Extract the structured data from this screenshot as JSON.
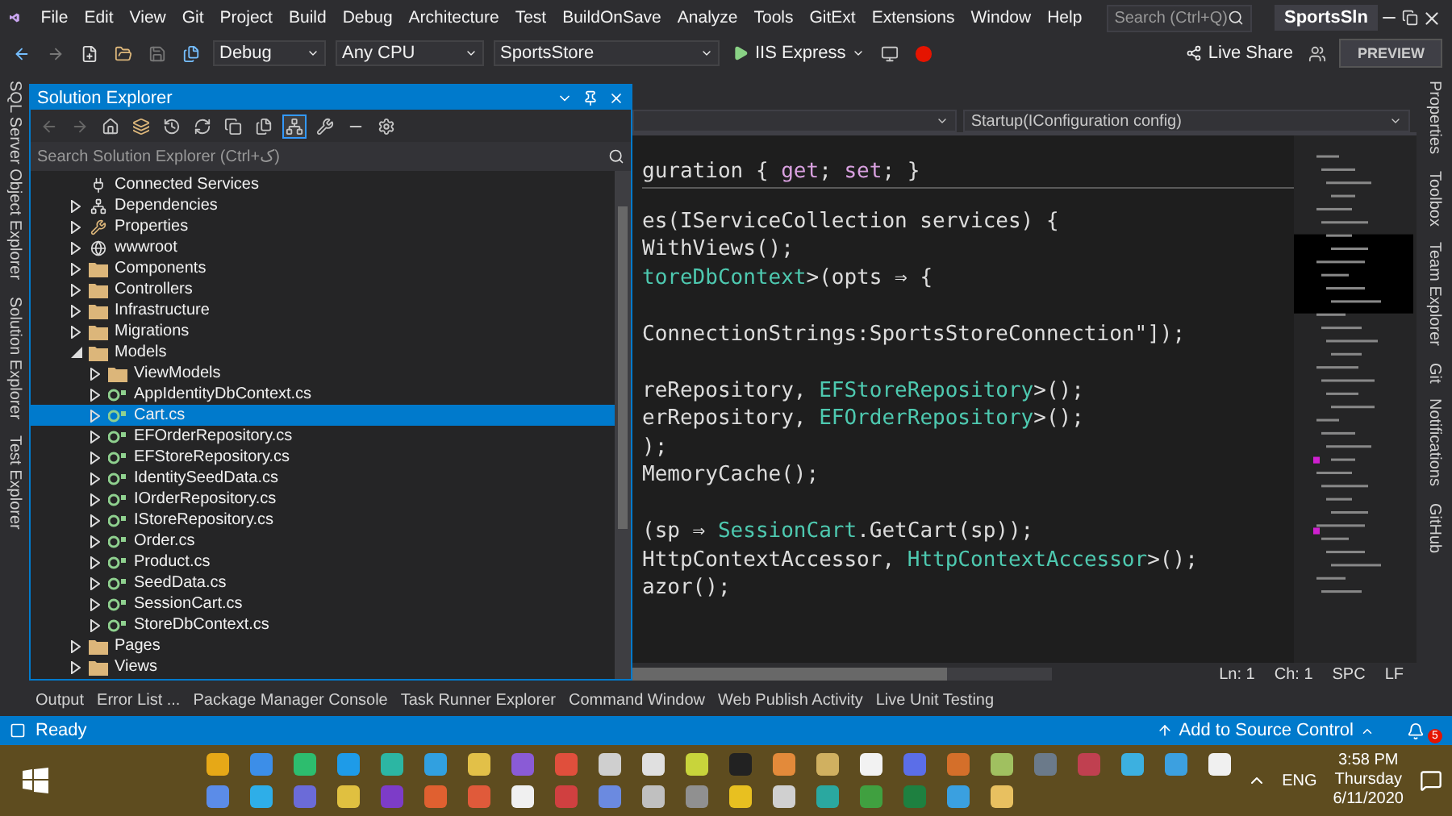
{
  "menu_bar": {
    "items": [
      "File",
      "Edit",
      "View",
      "Git",
      "Project",
      "Build",
      "Debug",
      "Architecture",
      "Test",
      "BuildOnSave",
      "Analyze",
      "Tools",
      "GitExt",
      "Extensions",
      "Window",
      "Help"
    ],
    "search": {
      "placeholder": "Search (Ctrl+Q)"
    },
    "solution_name": "SportsSln"
  },
  "toolbar": {
    "configuration": "Debug",
    "platform": "Any CPU",
    "startup_project": "SportsStore",
    "run_target": "IIS Express",
    "live_share": "Live Share",
    "preview": "PREVIEW"
  },
  "left_tabs": [
    "SQL Server Object Explorer",
    "Solution Explorer",
    "Test Explorer"
  ],
  "right_tabs": [
    "Properties",
    "Toolbox",
    "Team Explorer",
    "Git",
    "Notifications",
    "GitHub"
  ],
  "solution_explorer": {
    "title": "Solution Explorer",
    "toggle_on": true,
    "search": {
      "placeholder": "Search Solution Explorer (Ctrl+ک)"
    },
    "tree": [
      {
        "label": "Connected Services",
        "kind": "connected",
        "selected": false
      },
      {
        "label": "Dependencies",
        "kind": "dependencies",
        "expanded": false,
        "selected": false
      },
      {
        "label": "Properties",
        "kind": "properties",
        "expanded": false,
        "selected": false
      },
      {
        "label": "wwwroot",
        "kind": "globe",
        "expanded": false,
        "selected": false
      },
      {
        "label": "Components",
        "kind": "folder",
        "expanded": false,
        "selected": false
      },
      {
        "label": "Controllers",
        "kind": "folder",
        "expanded": false,
        "selected": false
      },
      {
        "label": "Infrastructure",
        "kind": "folder",
        "expanded": false,
        "selected": false
      },
      {
        "label": "Migrations",
        "kind": "folder",
        "expanded": false,
        "selected": false
      },
      {
        "label": "Models",
        "kind": "folder",
        "expanded": true,
        "selected": false,
        "children": [
          {
            "label": "ViewModels",
            "kind": "folder",
            "expanded": false,
            "selected": false
          },
          {
            "label": "AppIdentityDbContext.cs",
            "kind": "cs",
            "expanded": false,
            "selected": false
          },
          {
            "label": "Cart.cs",
            "kind": "cs",
            "expanded": false,
            "selected": true
          },
          {
            "label": "EFOrderRepository.cs",
            "kind": "cs",
            "expanded": false,
            "selected": false
          },
          {
            "label": "EFStoreRepository.cs",
            "kind": "cs",
            "expanded": false,
            "selected": false
          },
          {
            "label": "IdentitySeedData.cs",
            "kind": "cs",
            "expanded": false,
            "selected": false
          },
          {
            "label": "IOrderRepository.cs",
            "kind": "cs",
            "expanded": false,
            "selected": false
          },
          {
            "label": "IStoreRepository.cs",
            "kind": "cs",
            "expanded": false,
            "selected": false
          },
          {
            "label": "Order.cs",
            "kind": "cs",
            "expanded": false,
            "selected": false
          },
          {
            "label": "Product.cs",
            "kind": "cs",
            "expanded": false,
            "selected": false
          },
          {
            "label": "SeedData.cs",
            "kind": "cs",
            "expanded": false,
            "selected": false
          },
          {
            "label": "SessionCart.cs",
            "kind": "cs",
            "expanded": false,
            "selected": false
          },
          {
            "label": "StoreDbContext.cs",
            "kind": "cs",
            "expanded": false,
            "selected": false
          }
        ]
      },
      {
        "label": "Pages",
        "kind": "folder",
        "expanded": false,
        "selected": false
      },
      {
        "label": "Views",
        "kind": "folder",
        "expanded": false,
        "selected": false
      }
    ]
  },
  "editor": {
    "member_dropdown": "Startup(IConfiguration config)",
    "blocks": [
      [
        [
          {
            "text": "guration { ",
            "kind": "plain"
          },
          {
            "text": "get",
            "kind": "keyword"
          },
          {
            "text": "; ",
            "kind": "plain"
          },
          {
            "text": "set",
            "kind": "keyword"
          },
          {
            "text": "; }",
            "kind": "plain"
          }
        ]
      ],
      [
        [
          {
            "text": "es(IServiceCollection services) {",
            "kind": "plain"
          }
        ],
        [
          {
            "text": "WithViews();",
            "kind": "plain"
          }
        ],
        [
          {
            "text": "toreDbContext",
            "kind": "type"
          },
          {
            "text": ">(opts ⇒ {",
            "kind": "plain"
          }
        ]
      ],
      [
        [
          {
            "text": "ConnectionStrings:SportsStoreConnection\"]);",
            "kind": "plain"
          }
        ]
      ],
      [
        [
          {
            "text": "reRepository, ",
            "kind": "plain"
          },
          {
            "text": "EFStoreRepository",
            "kind": "type"
          },
          {
            "text": ">();",
            "kind": "plain"
          }
        ],
        [
          {
            "text": "erRepository, ",
            "kind": "plain"
          },
          {
            "text": "EFOrderRepository",
            "kind": "type"
          },
          {
            "text": ">();",
            "kind": "plain"
          }
        ],
        [
          {
            "text": ");",
            "kind": "plain"
          }
        ],
        [
          {
            "text": "MemoryCache();",
            "kind": "plain"
          }
        ]
      ],
      [
        [
          {
            "text": "(sp ⇒ ",
            "kind": "plain"
          },
          {
            "text": "SessionCart",
            "kind": "type"
          },
          {
            "text": ".GetCart(sp));",
            "kind": "plain"
          }
        ],
        [
          {
            "text": "HttpContextAccessor, ",
            "kind": "plain"
          },
          {
            "text": "HttpContextAccessor",
            "kind": "type"
          },
          {
            "text": ">();",
            "kind": "plain"
          }
        ],
        [
          {
            "text": "azor();",
            "kind": "plain"
          }
        ]
      ]
    ],
    "position": [
      "Ln: 1",
      "Ch: 1",
      "SPC",
      "LF"
    ]
  },
  "bottom_tabs": [
    "Output",
    "Error List ...",
    "Package Manager Console",
    "Task Runner Explorer",
    "Command Window",
    "Web Publish Activity",
    "Live Unit Testing"
  ],
  "status_bar": {
    "text": "Ready",
    "source_control": "Add to Source Control",
    "notifications": "5"
  },
  "taskbar": {
    "language": "ENG",
    "time": "3:58 PM",
    "day": "Thursday",
    "date": "6/11/2020"
  }
}
